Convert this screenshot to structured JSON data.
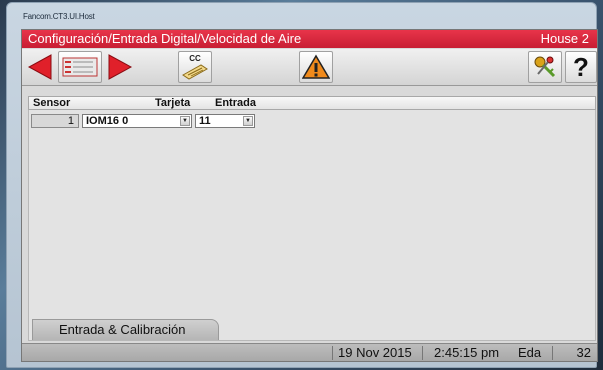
{
  "window": {
    "title": "Fancom.CT3.UI.Host"
  },
  "header": {
    "title": "Configuración/Entrada Digital/Velocidad de Aire",
    "house": "House 2"
  },
  "toolbar": {
    "cc_label": "CC",
    "help_label": "?"
  },
  "table": {
    "columns": [
      "Sensor",
      "Tarjeta",
      "Entrada"
    ],
    "rows": [
      {
        "sensor": "1",
        "tarjeta": "IOM16 0",
        "entrada": "11"
      }
    ]
  },
  "tabs": [
    {
      "label": "Entrada & Calibración"
    }
  ],
  "status": {
    "date": "19 Nov 2015",
    "time": "2:45:15 pm",
    "user": "Eda",
    "number": "32"
  },
  "colors": {
    "header_red": "#d9263c",
    "arrow_red": "#e0202a",
    "warning_orange": "#f08a1c"
  },
  "icons": [
    "arrow-left-icon",
    "list-icon",
    "arrow-right-icon",
    "calibration-card-icon",
    "warning-icon",
    "keys-icon",
    "help-icon"
  ]
}
